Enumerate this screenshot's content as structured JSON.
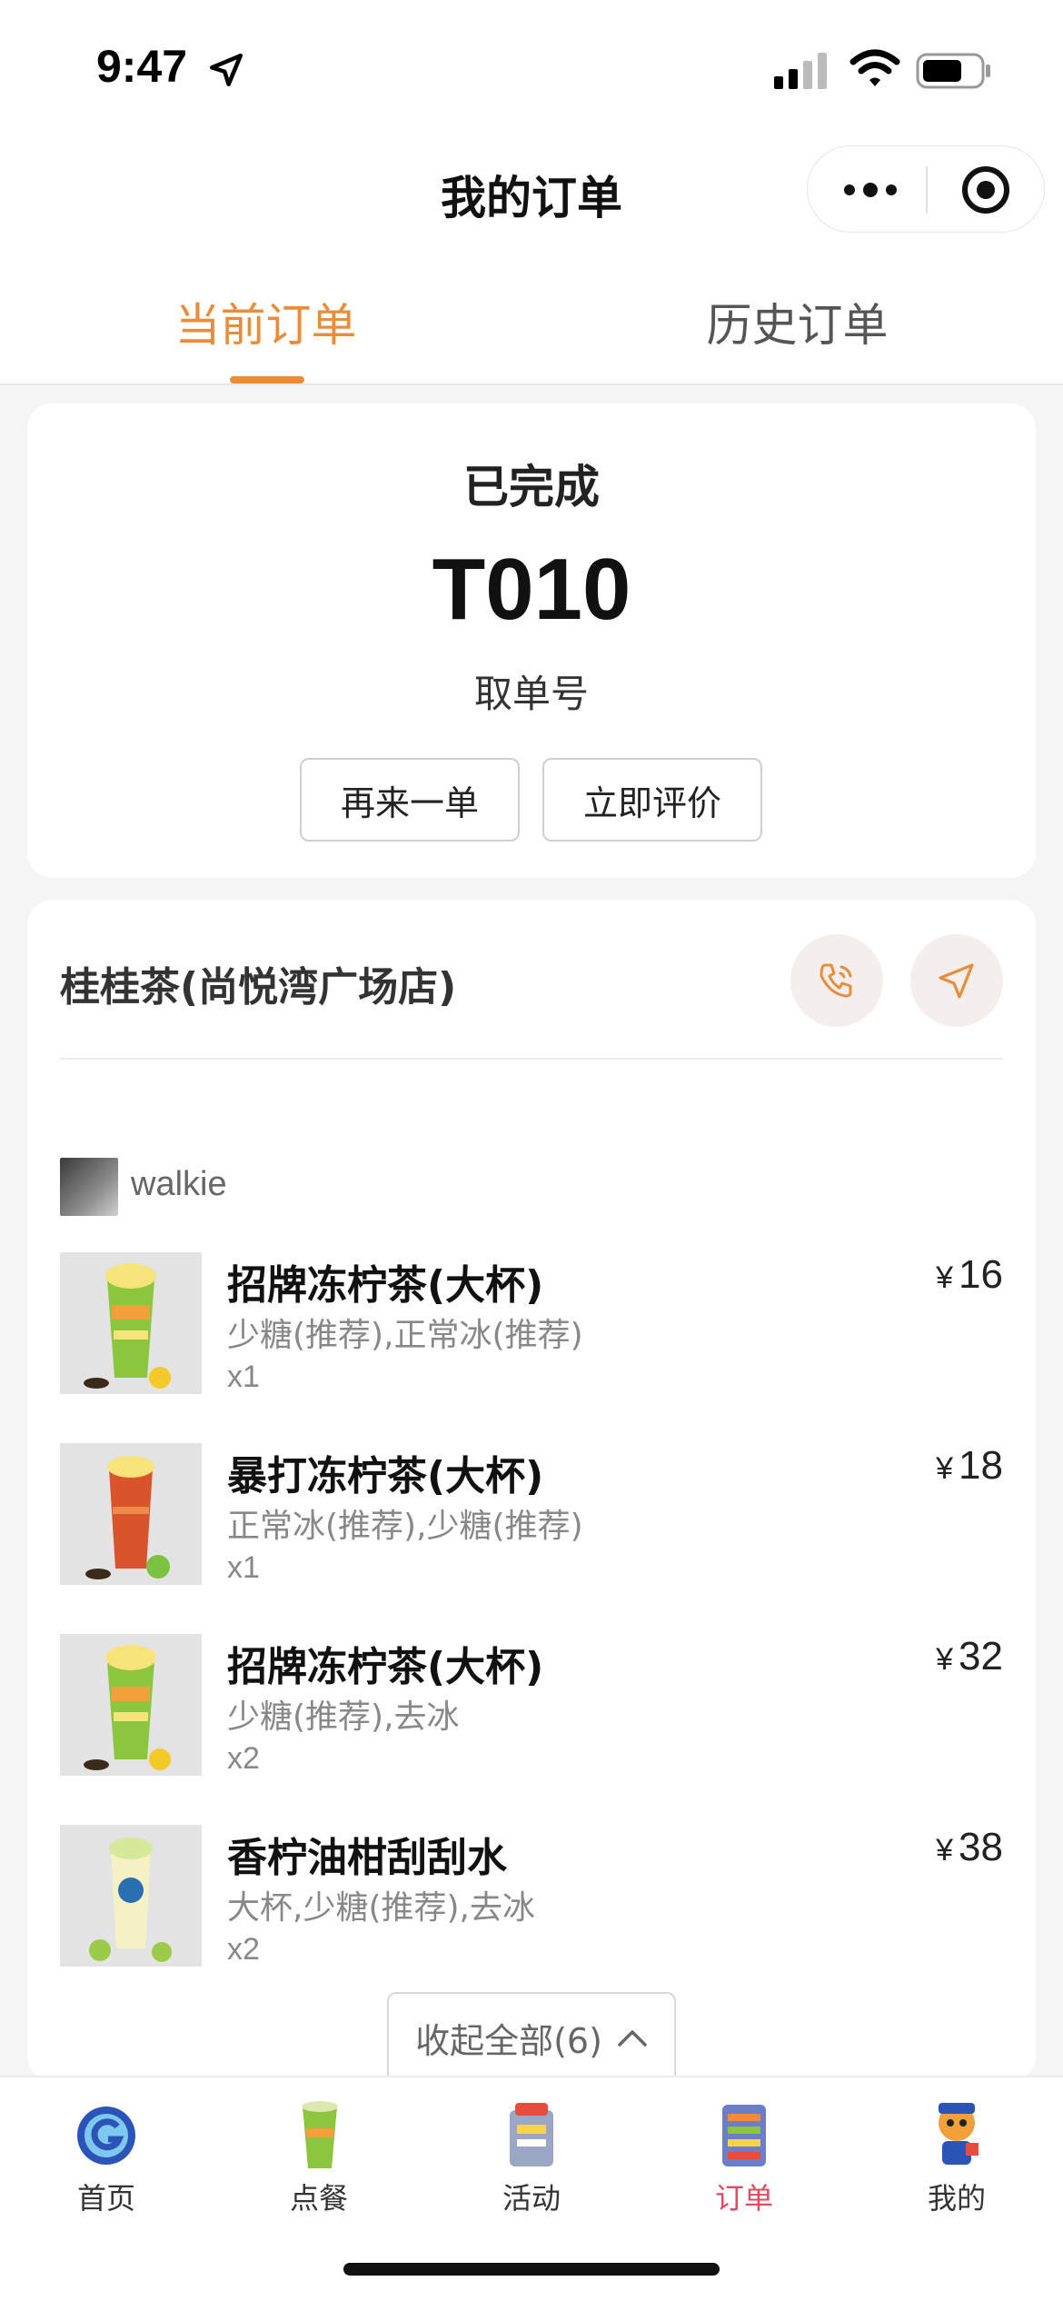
{
  "status_bar": {
    "time": "9:47"
  },
  "header": {
    "title": "我的订单"
  },
  "tabs": [
    {
      "label": "当前订单",
      "active": true
    },
    {
      "label": "历史订单",
      "active": false
    }
  ],
  "order_status": {
    "state": "已完成",
    "pickup_code": "T010",
    "pickup_label": "取单号",
    "reorder_label": "再来一单",
    "review_label": "立即评价"
  },
  "store": {
    "name": "桂桂茶(尚悦湾广场店)"
  },
  "user": {
    "name": "walkie"
  },
  "items": [
    {
      "name": "招牌冻柠茶(大杯)",
      "spec": "少糖(推荐),正常冰(推荐)",
      "qty": "x1",
      "currency": "¥",
      "price": "16",
      "image": "lemon-tea-green-cup"
    },
    {
      "name": "暴打冻柠茶(大杯)",
      "spec": "正常冰(推荐),少糖(推荐)",
      "qty": "x1",
      "currency": "¥",
      "price": "18",
      "image": "lemon-tea-red-cup"
    },
    {
      "name": "招牌冻柠茶(大杯)",
      "spec": "少糖(推荐),去冰",
      "qty": "x2",
      "currency": "¥",
      "price": "32",
      "image": "lemon-tea-green-cup"
    },
    {
      "name": "香柠油柑刮刮水",
      "spec": "大杯,少糖(推荐),去冰",
      "qty": "x2",
      "currency": "¥",
      "price": "38",
      "image": "citrus-drink-cup"
    }
  ],
  "collapse_label": "收起全部(6)",
  "tabbar": [
    {
      "label": "首页",
      "icon": "home-logo-icon",
      "active": false
    },
    {
      "label": "点餐",
      "icon": "drink-cup-icon",
      "active": false
    },
    {
      "label": "活动",
      "icon": "activity-icon",
      "active": false
    },
    {
      "label": "订单",
      "icon": "order-icon",
      "active": true
    },
    {
      "label": "我的",
      "icon": "mascot-icon",
      "active": false
    }
  ],
  "colors": {
    "accent": "#e88d3c",
    "tab_active": "#e04a5c"
  }
}
